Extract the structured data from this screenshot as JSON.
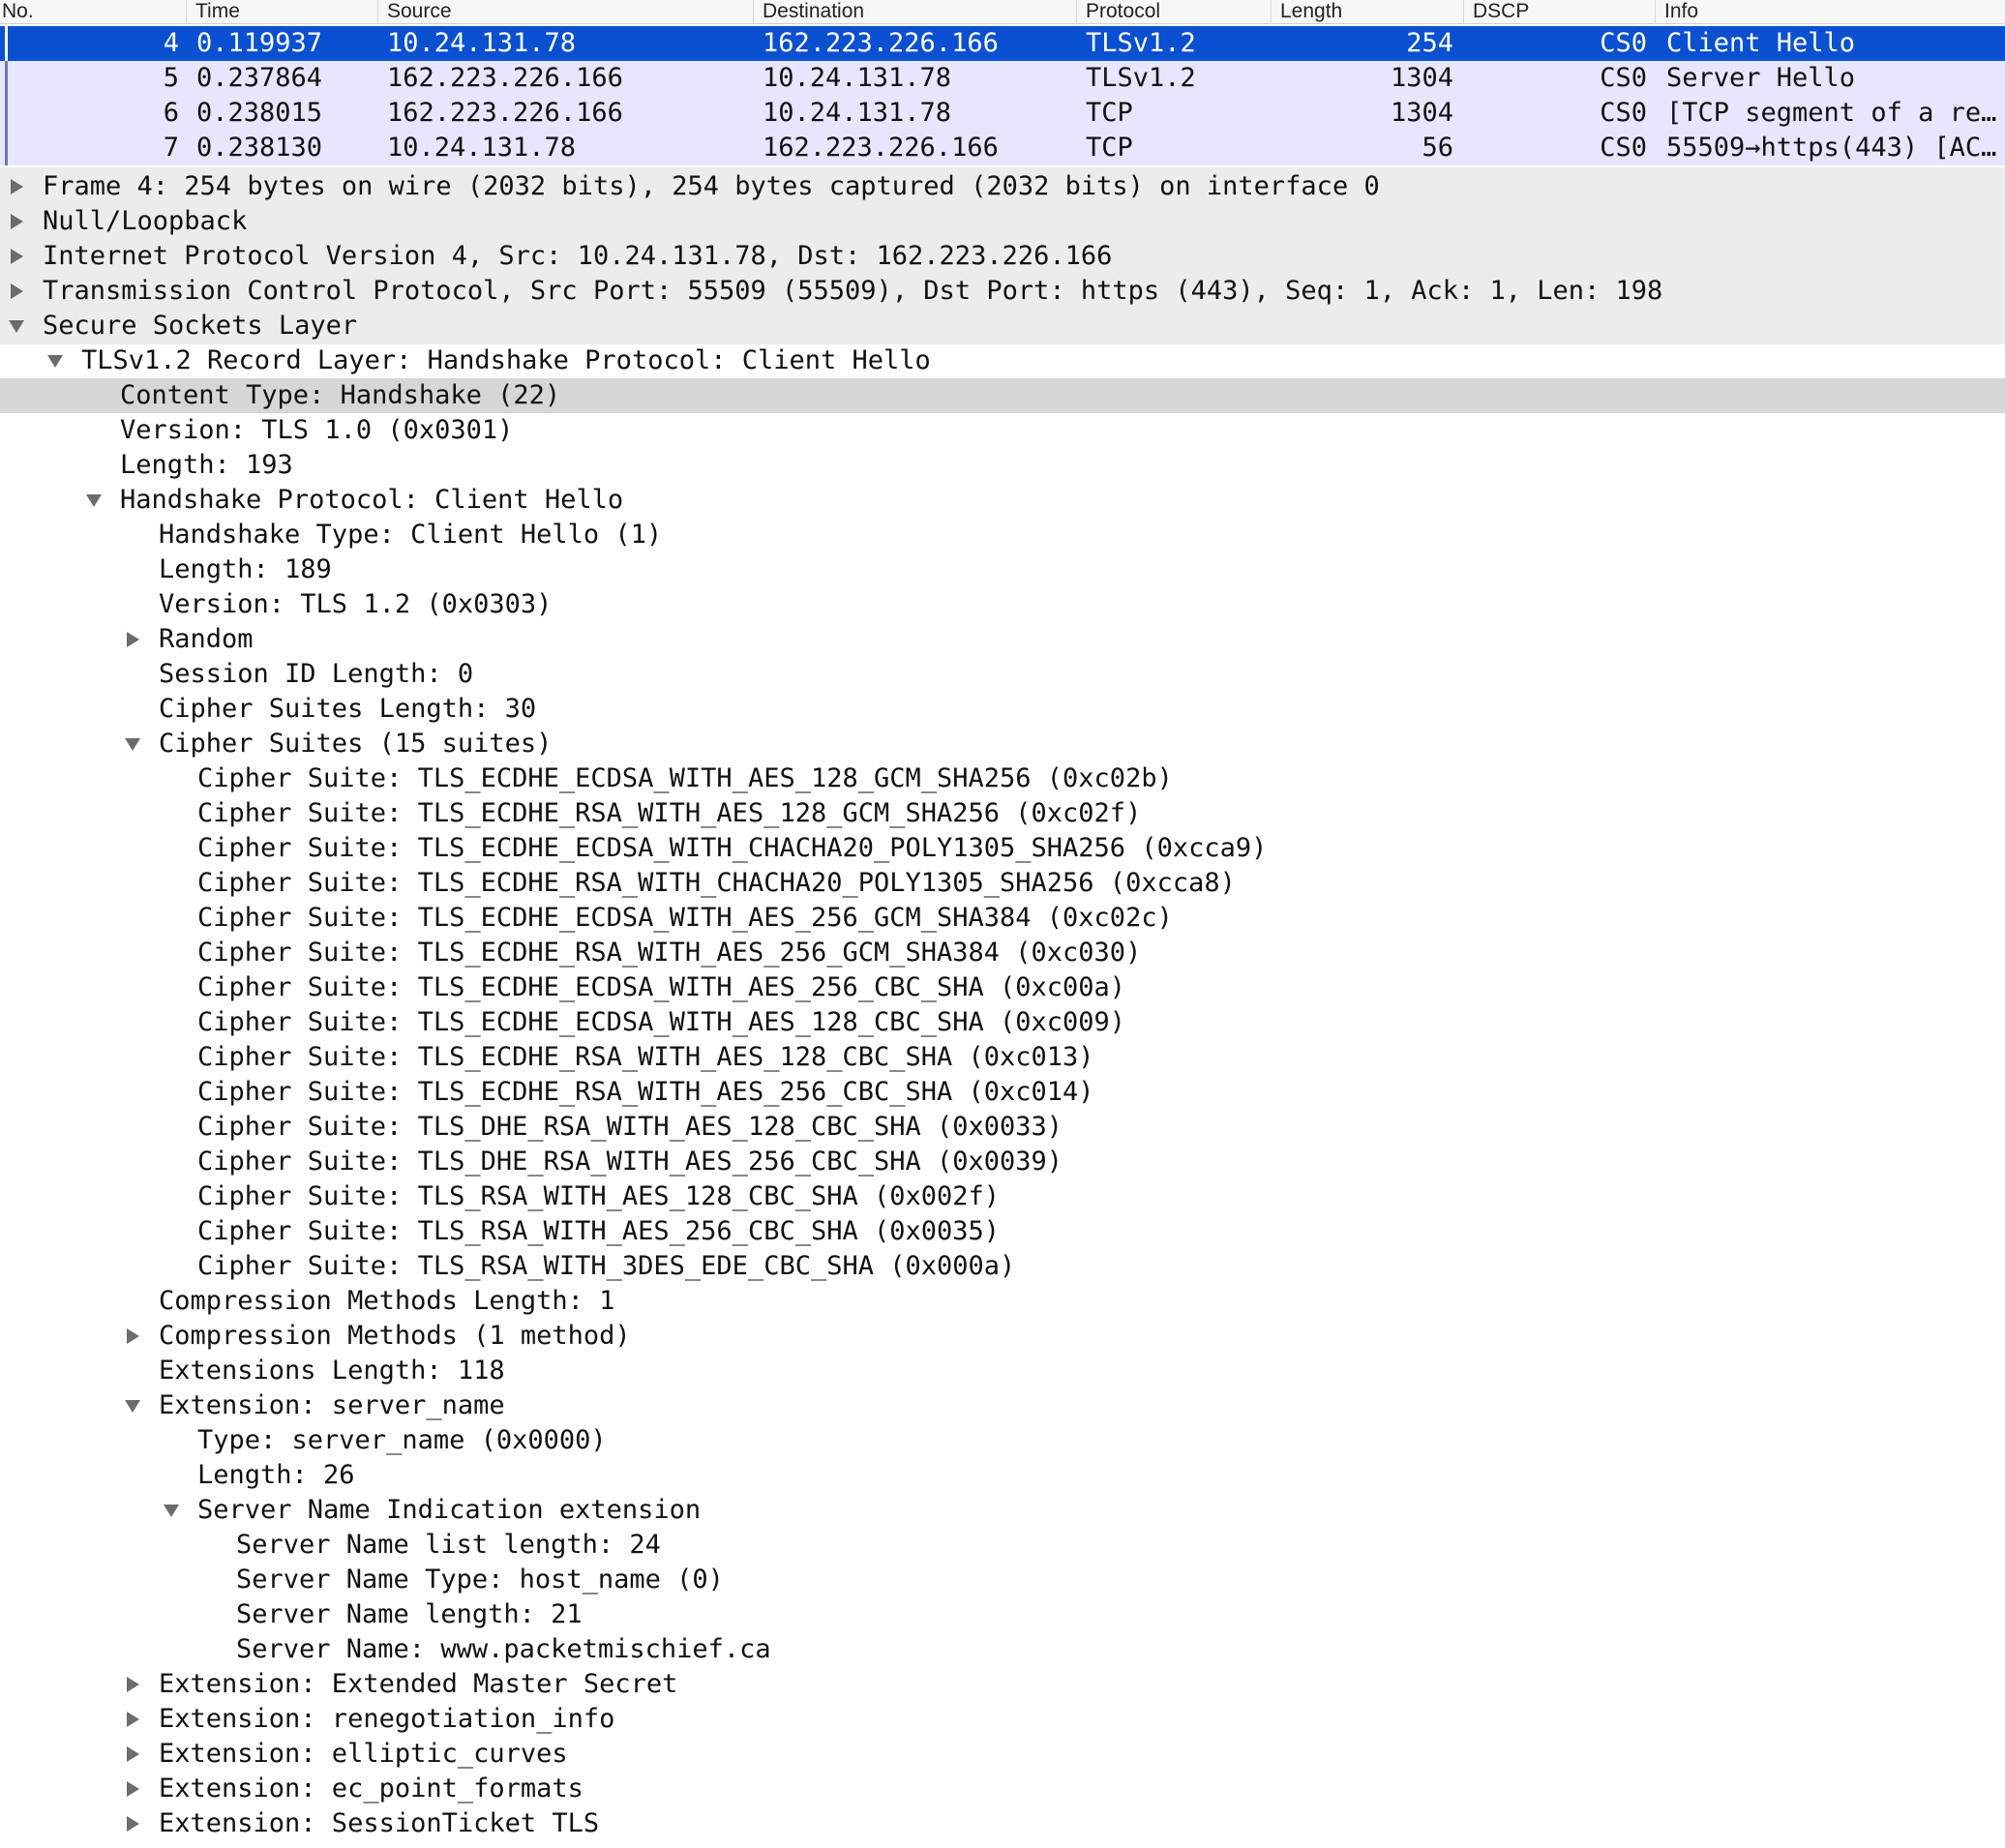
{
  "columns": {
    "no": "No.",
    "time": "Time",
    "source": "Source",
    "destination": "Destination",
    "protocol": "Protocol",
    "length": "Length",
    "dscp": "DSCP",
    "info": "Info"
  },
  "packets": [
    {
      "no": "4",
      "time": "0.119937",
      "source": "10.24.131.78",
      "destination": "162.223.226.166",
      "protocol": "TLSv1.2",
      "length": "254",
      "dscp": "CS0",
      "info": "Client Hello",
      "selected": true
    },
    {
      "no": "5",
      "time": "0.237864",
      "source": "162.223.226.166",
      "destination": "10.24.131.78",
      "protocol": "TLSv1.2",
      "length": "1304",
      "dscp": "CS0",
      "info": "Server Hello",
      "selected": false
    },
    {
      "no": "6",
      "time": "0.238015",
      "source": "162.223.226.166",
      "destination": "10.24.131.78",
      "protocol": "TCP",
      "length": "1304",
      "dscp": "CS0",
      "info": "[TCP segment of a re…",
      "selected": false
    },
    {
      "no": "7",
      "time": "0.238130",
      "source": "10.24.131.78",
      "destination": "162.223.226.166",
      "protocol": "TCP",
      "length": "56",
      "dscp": "CS0",
      "info": "55509→https(443) [AC…",
      "selected": false
    }
  ],
  "details": [
    {
      "text": "Frame 4: 254 bytes on wire (2032 bits), 254 bytes captured (2032 bits) on interface 0",
      "level": 0,
      "twisty": "collapsed",
      "selected": false
    },
    {
      "text": "Null/Loopback",
      "level": 0,
      "twisty": "collapsed",
      "selected": false
    },
    {
      "text": "Internet Protocol Version 4, Src: 10.24.131.78, Dst: 162.223.226.166",
      "level": 0,
      "twisty": "collapsed",
      "selected": false
    },
    {
      "text": "Transmission Control Protocol, Src Port: 55509 (55509), Dst Port: https (443), Seq: 1, Ack: 1, Len: 198",
      "level": 0,
      "twisty": "collapsed",
      "selected": false
    },
    {
      "text": "Secure Sockets Layer",
      "level": 0,
      "twisty": "expanded",
      "selected": false
    },
    {
      "text": "TLSv1.2 Record Layer: Handshake Protocol: Client Hello",
      "level": 1,
      "twisty": "expanded",
      "selected": false
    },
    {
      "text": "Content Type: Handshake (22)",
      "level": 2,
      "twisty": "none",
      "selected": true
    },
    {
      "text": "Version: TLS 1.0 (0x0301)",
      "level": 2,
      "twisty": "none",
      "selected": false
    },
    {
      "text": "Length: 193",
      "level": 2,
      "twisty": "none",
      "selected": false
    },
    {
      "text": "Handshake Protocol: Client Hello",
      "level": 2,
      "twisty": "expanded",
      "selected": false
    },
    {
      "text": "Handshake Type: Client Hello (1)",
      "level": 3,
      "twisty": "none",
      "selected": false
    },
    {
      "text": "Length: 189",
      "level": 3,
      "twisty": "none",
      "selected": false
    },
    {
      "text": "Version: TLS 1.2 (0x0303)",
      "level": 3,
      "twisty": "none",
      "selected": false
    },
    {
      "text": "Random",
      "level": 3,
      "twisty": "collapsed",
      "selected": false
    },
    {
      "text": "Session ID Length: 0",
      "level": 3,
      "twisty": "none",
      "selected": false
    },
    {
      "text": "Cipher Suites Length: 30",
      "level": 3,
      "twisty": "none",
      "selected": false
    },
    {
      "text": "Cipher Suites (15 suites)",
      "level": 3,
      "twisty": "expanded",
      "selected": false
    },
    {
      "text": "Cipher Suite: TLS_ECDHE_ECDSA_WITH_AES_128_GCM_SHA256 (0xc02b)",
      "level": 4,
      "twisty": "none",
      "selected": false
    },
    {
      "text": "Cipher Suite: TLS_ECDHE_RSA_WITH_AES_128_GCM_SHA256 (0xc02f)",
      "level": 4,
      "twisty": "none",
      "selected": false
    },
    {
      "text": "Cipher Suite: TLS_ECDHE_ECDSA_WITH_CHACHA20_POLY1305_SHA256 (0xcca9)",
      "level": 4,
      "twisty": "none",
      "selected": false
    },
    {
      "text": "Cipher Suite: TLS_ECDHE_RSA_WITH_CHACHA20_POLY1305_SHA256 (0xcca8)",
      "level": 4,
      "twisty": "none",
      "selected": false
    },
    {
      "text": "Cipher Suite: TLS_ECDHE_ECDSA_WITH_AES_256_GCM_SHA384 (0xc02c)",
      "level": 4,
      "twisty": "none",
      "selected": false
    },
    {
      "text": "Cipher Suite: TLS_ECDHE_RSA_WITH_AES_256_GCM_SHA384 (0xc030)",
      "level": 4,
      "twisty": "none",
      "selected": false
    },
    {
      "text": "Cipher Suite: TLS_ECDHE_ECDSA_WITH_AES_256_CBC_SHA (0xc00a)",
      "level": 4,
      "twisty": "none",
      "selected": false
    },
    {
      "text": "Cipher Suite: TLS_ECDHE_ECDSA_WITH_AES_128_CBC_SHA (0xc009)",
      "level": 4,
      "twisty": "none",
      "selected": false
    },
    {
      "text": "Cipher Suite: TLS_ECDHE_RSA_WITH_AES_128_CBC_SHA (0xc013)",
      "level": 4,
      "twisty": "none",
      "selected": false
    },
    {
      "text": "Cipher Suite: TLS_ECDHE_RSA_WITH_AES_256_CBC_SHA (0xc014)",
      "level": 4,
      "twisty": "none",
      "selected": false
    },
    {
      "text": "Cipher Suite: TLS_DHE_RSA_WITH_AES_128_CBC_SHA (0x0033)",
      "level": 4,
      "twisty": "none",
      "selected": false
    },
    {
      "text": "Cipher Suite: TLS_DHE_RSA_WITH_AES_256_CBC_SHA (0x0039)",
      "level": 4,
      "twisty": "none",
      "selected": false
    },
    {
      "text": "Cipher Suite: TLS_RSA_WITH_AES_128_CBC_SHA (0x002f)",
      "level": 4,
      "twisty": "none",
      "selected": false
    },
    {
      "text": "Cipher Suite: TLS_RSA_WITH_AES_256_CBC_SHA (0x0035)",
      "level": 4,
      "twisty": "none",
      "selected": false
    },
    {
      "text": "Cipher Suite: TLS_RSA_WITH_3DES_EDE_CBC_SHA (0x000a)",
      "level": 4,
      "twisty": "none",
      "selected": false
    },
    {
      "text": "Compression Methods Length: 1",
      "level": 3,
      "twisty": "none",
      "selected": false
    },
    {
      "text": "Compression Methods (1 method)",
      "level": 3,
      "twisty": "collapsed",
      "selected": false
    },
    {
      "text": "Extensions Length: 118",
      "level": 3,
      "twisty": "none",
      "selected": false
    },
    {
      "text": "Extension: server_name",
      "level": 3,
      "twisty": "expanded",
      "selected": false
    },
    {
      "text": "Type: server_name (0x0000)",
      "level": 4,
      "twisty": "none",
      "selected": false
    },
    {
      "text": "Length: 26",
      "level": 4,
      "twisty": "none",
      "selected": false
    },
    {
      "text": "Server Name Indication extension",
      "level": 4,
      "twisty": "expanded",
      "selected": false
    },
    {
      "text": "Server Name list length: 24",
      "level": 5,
      "twisty": "none",
      "selected": false
    },
    {
      "text": "Server Name Type: host_name (0)",
      "level": 5,
      "twisty": "none",
      "selected": false
    },
    {
      "text": "Server Name length: 21",
      "level": 5,
      "twisty": "none",
      "selected": false
    },
    {
      "text": "Server Name: www.packetmischief.ca",
      "level": 5,
      "twisty": "none",
      "selected": false
    },
    {
      "text": "Extension: Extended Master Secret",
      "level": 3,
      "twisty": "collapsed",
      "selected": false
    },
    {
      "text": "Extension: renegotiation_info",
      "level": 3,
      "twisty": "collapsed",
      "selected": false
    },
    {
      "text": "Extension: elliptic_curves",
      "level": 3,
      "twisty": "collapsed",
      "selected": false
    },
    {
      "text": "Extension: ec_point_formats",
      "level": 3,
      "twisty": "collapsed",
      "selected": false
    },
    {
      "text": "Extension: SessionTicket TLS",
      "level": 3,
      "twisty": "collapsed",
      "selected": false
    }
  ],
  "colors": {
    "selected_row": "#0b50d1",
    "packet_row": "#e6e6ff",
    "detail_highlight": "#d6d6d6",
    "twisty": "#6c6c6c"
  }
}
